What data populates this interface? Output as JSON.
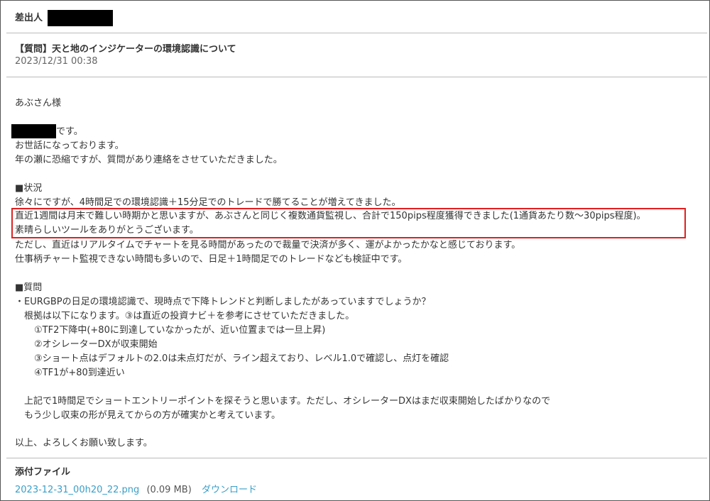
{
  "header": {
    "sender_label": "差出人",
    "subject": "【質問】天と地のインジケーターの環境認識について",
    "datetime": "2023/12/31 00:38"
  },
  "body": {
    "lines": [
      "あぶさん様",
      "です。",
      "お世話になっております。",
      "年の瀬に恐縮ですが、質問があり連絡をさせていただきました。",
      "■状況",
      "徐々にですが、4時間足での環境認識＋15分足でのトレードで勝てることが増えてきました。",
      "直近1週間は月末で難しい時期かと思いますが、あぶさんと同じく複数通貨監視し、合計で150pips程度獲得できました(1通貨あたり数～30pips程度)。",
      "素晴らしいツールをありがとうございます。",
      "ただし、直近はリアルタイムでチャートを見る時間があったので裁量で決済が多く、運がよかったかなと感じております。",
      "仕事柄チャート監視できない時間も多いので、日足＋1時間足でのトレードなども検証中です。",
      "■質問",
      "・EURGBPの日足の環境認識で、現時点で下降トレンドと判断しましたがあっていますでしょうか？",
      "根拠は以下になります。③は直近の投資ナビ＋を参考にさせていただきました。",
      "①TF2下降中(+80に到達していなかったが、近い位置までは一旦上昇)",
      "②オシレーターDXが収束開始",
      "③ショート点はデフォルトの2.0は未点灯だが、ライン超えており、レベル1.0で確認し、点灯を確認",
      "④TF1が+80到達近い",
      "上記で1時間足でショートエントリーポイントを探そうと思います。ただし、オシレーターDXはまだ収束開始したばかりなので",
      "もう少し収束の形が見えてからの方が確実かと考えています。",
      "以上、よろしくお願い致します。"
    ]
  },
  "attachments": {
    "title": "添付ファイル",
    "file_name": "2023-12-31_00h20_22.png",
    "file_size": "(0.09 MB)",
    "download_label": "ダウンロード"
  },
  "colors": {
    "highlight_border": "#e02020",
    "link": "#3a9fc8",
    "redaction": "#000000"
  }
}
